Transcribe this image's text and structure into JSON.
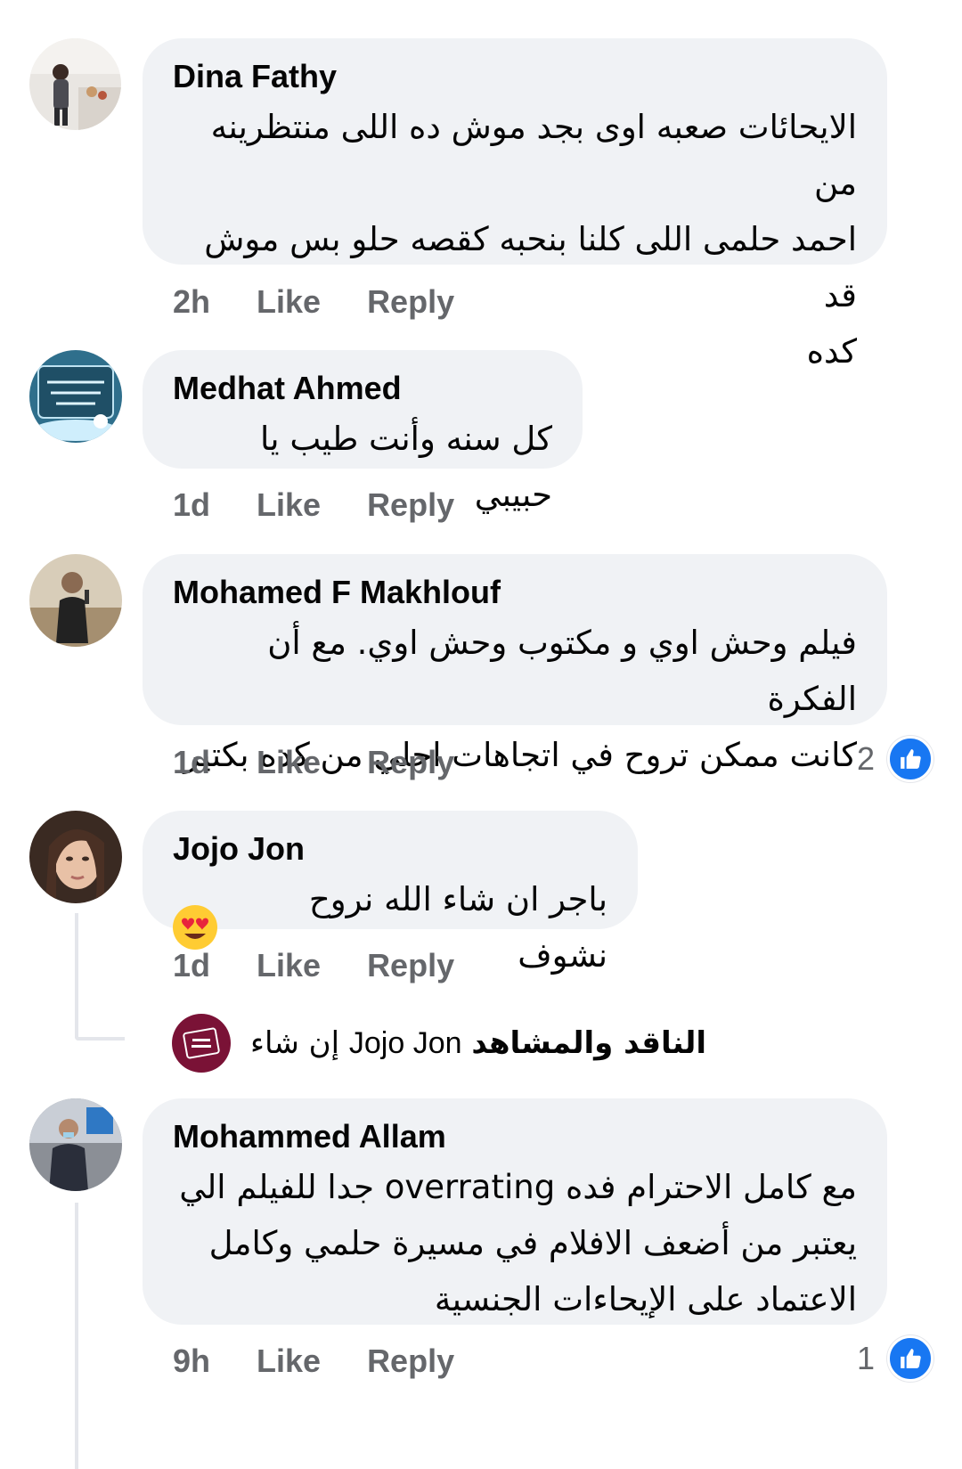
{
  "comments": [
    {
      "author": "Dina Fathy",
      "lines": [
        "الايحائات  صعبه اوى بجد موش ده اللى منتظرينه من",
        "احمد حلمى اللى كلنا  بنحبه  كقصه حلو بس موش قد",
        "كده"
      ],
      "time": "2h",
      "like_label": "Like",
      "reply_label": "Reply"
    },
    {
      "author": "Medhat Ahmed",
      "lines": [
        "كل سنه وأنت طيب يا حبيبي"
      ],
      "time": "1d",
      "like_label": "Like",
      "reply_label": "Reply"
    },
    {
      "author": "Mohamed F Makhlouf",
      "lines": [
        "فيلم وحش اوي و مكتوب وحش اوي. مع أن الفكرة",
        "كانت ممكن تروح في اتجاهات احلي من كده بكتير"
      ],
      "time": "1d",
      "like_label": "Like",
      "reply_label": "Reply",
      "reaction_count": "2"
    },
    {
      "author": "Jojo Jon",
      "lines": [
        "باجر ان شاء الله نروح نشوف"
      ],
      "time": "1d",
      "like_label": "Like",
      "reply_label": "Reply",
      "reply_preview": {
        "page_name": "الناقد والمشاهد",
        "mention": "Jojo Jon",
        "text": "إن شاء"
      }
    },
    {
      "author": "Mohammed Allam",
      "lines": [
        "مع كامل الاحترام فده overrating جدا للفيلم الي",
        "يعتبر من أضعف الافلام في مسيرة حلمي وكامل",
        "الاعتماد على الإيحاءات الجنسية"
      ],
      "time": "9h",
      "like_label": "Like",
      "reply_label": "Reply",
      "reaction_count": "1"
    }
  ],
  "colors": {
    "bubble": "#f0f2f5",
    "secondary_text": "#65676b",
    "like_blue": "#1877f2"
  }
}
